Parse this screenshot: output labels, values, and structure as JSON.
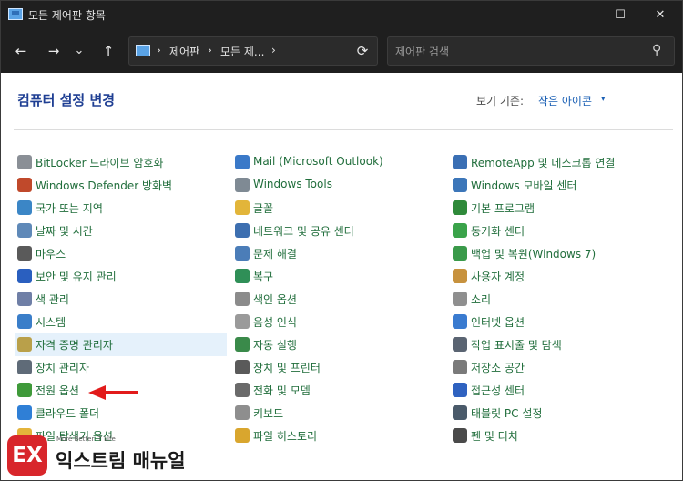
{
  "window": {
    "title": "모든 제어판 항목",
    "controls": {
      "minimize": "—",
      "maximize": "☐",
      "close": "✕"
    }
  },
  "toolbar": {
    "back_glyph": "←",
    "forward_glyph": "→",
    "recent_glyph": "⌄",
    "up_glyph": "↑",
    "breadcrumb": [
      "제어판",
      "모든 제..."
    ],
    "breadcrumb_sep": "›",
    "refresh_glyph": "⟳",
    "search_placeholder": "제어판 검색",
    "search_glyph": "⚲"
  },
  "page": {
    "heading": "컴퓨터 설정 변경",
    "view_by_label": "보기 기준:",
    "view_by_value": "작은 아이콘",
    "view_caret": "▾"
  },
  "columns": [
    [
      {
        "label": "BitLocker 드라이브 암호화",
        "icon": "bitlocker-icon",
        "color": "#8a8f96"
      },
      {
        "label": "Windows Defender 방화벽",
        "icon": "firewall-icon",
        "color": "#c0492b"
      },
      {
        "label": "국가 또는 지역",
        "icon": "region-icon",
        "color": "#3b86c6"
      },
      {
        "label": "날짜 및 시간",
        "icon": "clock-icon",
        "color": "#5f89b8"
      },
      {
        "label": "마우스",
        "icon": "mouse-icon",
        "color": "#5a5a5a"
      },
      {
        "label": "보안 및 유지 관리",
        "icon": "flag-icon",
        "color": "#2a5fbf"
      },
      {
        "label": "색 관리",
        "icon": "color-management-icon",
        "color": "#6f7fa6"
      },
      {
        "label": "시스템",
        "icon": "system-icon",
        "color": "#3a7ec9"
      },
      {
        "label": "자격 증명 관리자",
        "icon": "credential-icon",
        "color": "#b9a04a"
      },
      {
        "label": "장치 관리자",
        "icon": "device-manager-icon",
        "color": "#5f6b78"
      },
      {
        "label": "전원 옵션",
        "icon": "power-icon",
        "color": "#3f9a3a"
      },
      {
        "label": "클라우드 폴더",
        "icon": "cloud-folder-icon",
        "color": "#2f7fd6"
      },
      {
        "label": "파일 탐색기 옵션",
        "icon": "folder-options-icon",
        "color": "#e4b43b"
      }
    ],
    [
      {
        "label": "Mail (Microsoft Outlook)",
        "icon": "mail-icon",
        "color": "#3a79c8"
      },
      {
        "label": "Windows Tools",
        "icon": "tools-icon",
        "color": "#7f8a94"
      },
      {
        "label": "글꼴",
        "icon": "fonts-icon",
        "color": "#e2b53a"
      },
      {
        "label": "네트워크 및 공유 센터",
        "icon": "network-icon",
        "color": "#3d6fb0"
      },
      {
        "label": "문제 해결",
        "icon": "troubleshoot-icon",
        "color": "#4b7db8"
      },
      {
        "label": "복구",
        "icon": "recovery-icon",
        "color": "#2f8f57"
      },
      {
        "label": "색인 옵션",
        "icon": "indexing-icon",
        "color": "#8b8b8b"
      },
      {
        "label": "음성 인식",
        "icon": "microphone-icon",
        "color": "#9a9a9a"
      },
      {
        "label": "자동 실행",
        "icon": "autoplay-icon",
        "color": "#3a8a4a"
      },
      {
        "label": "장치 및 프린터",
        "icon": "printer-icon",
        "color": "#5a5a5a"
      },
      {
        "label": "전화 및 모뎀",
        "icon": "phone-icon",
        "color": "#6a6a6a"
      },
      {
        "label": "키보드",
        "icon": "keyboard-icon",
        "color": "#8e8e8e"
      },
      {
        "label": "파일 히스토리",
        "icon": "file-history-icon",
        "color": "#d9a62e"
      }
    ],
    [
      {
        "label": "RemoteApp 및 데스크톱 연결",
        "icon": "remoteapp-icon",
        "color": "#3a6fb4"
      },
      {
        "label": "Windows 모바일 센터",
        "icon": "mobility-icon",
        "color": "#3c76b9"
      },
      {
        "label": "기본 프로그램",
        "icon": "default-programs-icon",
        "color": "#2f8a3a"
      },
      {
        "label": "동기화 센터",
        "icon": "sync-icon",
        "color": "#3aa34a"
      },
      {
        "label": "백업 및 복원(Windows 7)",
        "icon": "backup-icon",
        "color": "#3a9a4a"
      },
      {
        "label": "사용자 계정",
        "icon": "user-accounts-icon",
        "color": "#c7923e"
      },
      {
        "label": "소리",
        "icon": "sound-icon",
        "color": "#8f8f8f"
      },
      {
        "label": "인터넷 옵션",
        "icon": "internet-options-icon",
        "color": "#3a7bd0"
      },
      {
        "label": "작업 표시줄 및 탐색",
        "icon": "taskbar-icon",
        "color": "#5a6472"
      },
      {
        "label": "저장소 공간",
        "icon": "storage-icon",
        "color": "#7a7a7a"
      },
      {
        "label": "접근성 센터",
        "icon": "accessibility-icon",
        "color": "#2f62c0"
      },
      {
        "label": "태블릿 PC 설정",
        "icon": "tablet-icon",
        "color": "#4a5a6a"
      },
      {
        "label": "펜 및 터치",
        "icon": "pen-icon",
        "color": "#4a4a4a"
      }
    ]
  ],
  "selected_item": "자격 증명 관리자",
  "annotation": {
    "arrow_color": "#e21b1b",
    "points_to": "전원 옵션"
  },
  "watermark": {
    "logo_text": "EX",
    "tagline": "More Better IT Life",
    "name": "익스트림 매뉴얼",
    "brand_color": "#d8262b"
  }
}
